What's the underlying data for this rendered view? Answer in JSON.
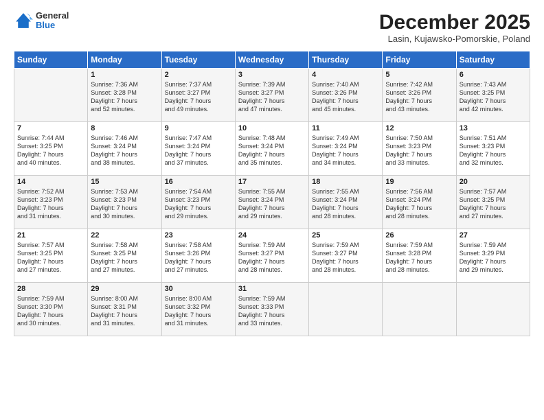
{
  "logo": {
    "general": "General",
    "blue": "Blue"
  },
  "header": {
    "month": "December 2025",
    "location": "Lasin, Kujawsko-Pomorskie, Poland"
  },
  "weekdays": [
    "Sunday",
    "Monday",
    "Tuesday",
    "Wednesday",
    "Thursday",
    "Friday",
    "Saturday"
  ],
  "weeks": [
    [
      {
        "day": "",
        "info": ""
      },
      {
        "day": "1",
        "info": "Sunrise: 7:36 AM\nSunset: 3:28 PM\nDaylight: 7 hours\nand 52 minutes."
      },
      {
        "day": "2",
        "info": "Sunrise: 7:37 AM\nSunset: 3:27 PM\nDaylight: 7 hours\nand 49 minutes."
      },
      {
        "day": "3",
        "info": "Sunrise: 7:39 AM\nSunset: 3:27 PM\nDaylight: 7 hours\nand 47 minutes."
      },
      {
        "day": "4",
        "info": "Sunrise: 7:40 AM\nSunset: 3:26 PM\nDaylight: 7 hours\nand 45 minutes."
      },
      {
        "day": "5",
        "info": "Sunrise: 7:42 AM\nSunset: 3:26 PM\nDaylight: 7 hours\nand 43 minutes."
      },
      {
        "day": "6",
        "info": "Sunrise: 7:43 AM\nSunset: 3:25 PM\nDaylight: 7 hours\nand 42 minutes."
      }
    ],
    [
      {
        "day": "7",
        "info": "Sunrise: 7:44 AM\nSunset: 3:25 PM\nDaylight: 7 hours\nand 40 minutes."
      },
      {
        "day": "8",
        "info": "Sunrise: 7:46 AM\nSunset: 3:24 PM\nDaylight: 7 hours\nand 38 minutes."
      },
      {
        "day": "9",
        "info": "Sunrise: 7:47 AM\nSunset: 3:24 PM\nDaylight: 7 hours\nand 37 minutes."
      },
      {
        "day": "10",
        "info": "Sunrise: 7:48 AM\nSunset: 3:24 PM\nDaylight: 7 hours\nand 35 minutes."
      },
      {
        "day": "11",
        "info": "Sunrise: 7:49 AM\nSunset: 3:24 PM\nDaylight: 7 hours\nand 34 minutes."
      },
      {
        "day": "12",
        "info": "Sunrise: 7:50 AM\nSunset: 3:23 PM\nDaylight: 7 hours\nand 33 minutes."
      },
      {
        "day": "13",
        "info": "Sunrise: 7:51 AM\nSunset: 3:23 PM\nDaylight: 7 hours\nand 32 minutes."
      }
    ],
    [
      {
        "day": "14",
        "info": "Sunrise: 7:52 AM\nSunset: 3:23 PM\nDaylight: 7 hours\nand 31 minutes."
      },
      {
        "day": "15",
        "info": "Sunrise: 7:53 AM\nSunset: 3:23 PM\nDaylight: 7 hours\nand 30 minutes."
      },
      {
        "day": "16",
        "info": "Sunrise: 7:54 AM\nSunset: 3:23 PM\nDaylight: 7 hours\nand 29 minutes."
      },
      {
        "day": "17",
        "info": "Sunrise: 7:55 AM\nSunset: 3:24 PM\nDaylight: 7 hours\nand 29 minutes."
      },
      {
        "day": "18",
        "info": "Sunrise: 7:55 AM\nSunset: 3:24 PM\nDaylight: 7 hours\nand 28 minutes."
      },
      {
        "day": "19",
        "info": "Sunrise: 7:56 AM\nSunset: 3:24 PM\nDaylight: 7 hours\nand 28 minutes."
      },
      {
        "day": "20",
        "info": "Sunrise: 7:57 AM\nSunset: 3:25 PM\nDaylight: 7 hours\nand 27 minutes."
      }
    ],
    [
      {
        "day": "21",
        "info": "Sunrise: 7:57 AM\nSunset: 3:25 PM\nDaylight: 7 hours\nand 27 minutes."
      },
      {
        "day": "22",
        "info": "Sunrise: 7:58 AM\nSunset: 3:25 PM\nDaylight: 7 hours\nand 27 minutes."
      },
      {
        "day": "23",
        "info": "Sunrise: 7:58 AM\nSunset: 3:26 PM\nDaylight: 7 hours\nand 27 minutes."
      },
      {
        "day": "24",
        "info": "Sunrise: 7:59 AM\nSunset: 3:27 PM\nDaylight: 7 hours\nand 28 minutes."
      },
      {
        "day": "25",
        "info": "Sunrise: 7:59 AM\nSunset: 3:27 PM\nDaylight: 7 hours\nand 28 minutes."
      },
      {
        "day": "26",
        "info": "Sunrise: 7:59 AM\nSunset: 3:28 PM\nDaylight: 7 hours\nand 28 minutes."
      },
      {
        "day": "27",
        "info": "Sunrise: 7:59 AM\nSunset: 3:29 PM\nDaylight: 7 hours\nand 29 minutes."
      }
    ],
    [
      {
        "day": "28",
        "info": "Sunrise: 7:59 AM\nSunset: 3:30 PM\nDaylight: 7 hours\nand 30 minutes."
      },
      {
        "day": "29",
        "info": "Sunrise: 8:00 AM\nSunset: 3:31 PM\nDaylight: 7 hours\nand 31 minutes."
      },
      {
        "day": "30",
        "info": "Sunrise: 8:00 AM\nSunset: 3:32 PM\nDaylight: 7 hours\nand 31 minutes."
      },
      {
        "day": "31",
        "info": "Sunrise: 7:59 AM\nSunset: 3:33 PM\nDaylight: 7 hours\nand 33 minutes."
      },
      {
        "day": "",
        "info": ""
      },
      {
        "day": "",
        "info": ""
      },
      {
        "day": "",
        "info": ""
      }
    ]
  ]
}
